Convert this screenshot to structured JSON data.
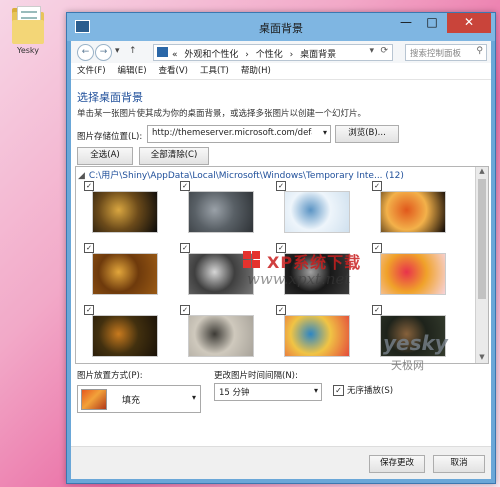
{
  "desktop": {
    "icon_label": "Yesky"
  },
  "window": {
    "title": "桌面背景"
  },
  "nav": {
    "breadcrumb": [
      "外观和个性化",
      "个性化",
      "桌面背景"
    ],
    "search_placeholder": "搜索控制面板"
  },
  "menu": [
    "文件(F)",
    "编辑(E)",
    "查看(V)",
    "工具(T)",
    "帮助(H)"
  ],
  "content": {
    "heading": "选择桌面背景",
    "description": "单击某一张图片使其成为你的桌面背景，或选择多张图片以创建一个幻灯片。",
    "location_label": "图片存储位置(L):",
    "location_value": "http://themeserver.microsoft.com/defa",
    "browse_button": "浏览(B)...",
    "select_all": "全选(A)",
    "clear_all": "全部清除(C)",
    "folder_path": "C:\\用户\\Shiny\\AppData\\Local\\Microsoft\\Windows\\Temporary Inte...  (12)"
  },
  "thumbnails": [
    {
      "checked": true,
      "colors": [
        "#0a0a0a",
        "#d9a640",
        "#6b4a1a"
      ]
    },
    {
      "checked": true,
      "colors": [
        "#2e3236",
        "#9aa1a8",
        "#596066"
      ]
    },
    {
      "checked": true,
      "colors": [
        "#cfe0ee",
        "#5b94c4",
        "#eef5fb"
      ]
    },
    {
      "checked": true,
      "colors": [
        "#0d0705",
        "#e0581c",
        "#f3b14a"
      ]
    },
    {
      "checked": true,
      "colors": [
        "#9a5a14",
        "#e2a63b",
        "#6e3a0c"
      ]
    },
    {
      "checked": true,
      "colors": [
        "#777",
        "#d6d6d6",
        "#3f3f3f"
      ]
    },
    {
      "checked": true,
      "colors": [
        "#3c3c3c",
        "#a2a2a2",
        "#181818"
      ]
    },
    {
      "checked": true,
      "colors": [
        "#f7d3da",
        "#e8334b",
        "#f0a22a"
      ]
    },
    {
      "checked": true,
      "colors": [
        "#1a1208",
        "#c87a1e",
        "#42300f"
      ]
    },
    {
      "checked": true,
      "colors": [
        "#a8a39a",
        "#3d3b36",
        "#cfc9bd"
      ]
    },
    {
      "checked": true,
      "colors": [
        "#e44b3b",
        "#2d86c4",
        "#f0c445"
      ]
    },
    {
      "checked": true,
      "colors": [
        "#343b2d",
        "#86613b",
        "#1e231b"
      ]
    }
  ],
  "watermarks": {
    "xp_text": "XP系统下载",
    "xp_url": "www.xpxt.net",
    "yesky": "yesky",
    "yesky_cn": "天极网"
  },
  "options": {
    "position_label": "图片放置方式(P):",
    "position_value": "填充",
    "interval_label": "更改图片时间间隔(N):",
    "interval_value": "15 分钟",
    "shuffle_label": "无序播放(S)",
    "shuffle_checked": true
  },
  "footer": {
    "save": "保存更改",
    "cancel": "取消"
  }
}
